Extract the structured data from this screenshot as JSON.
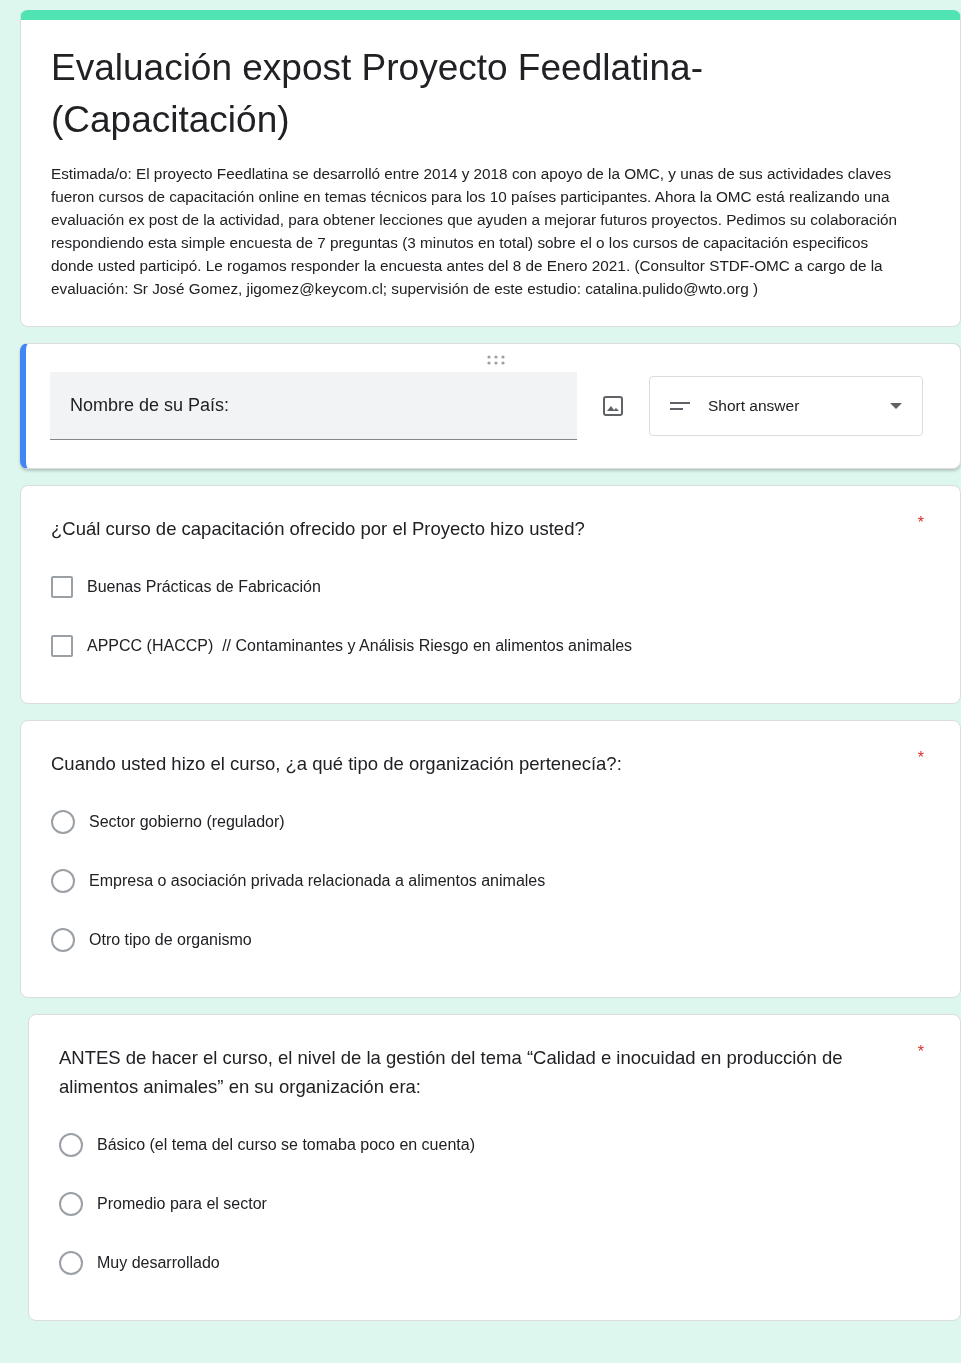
{
  "form": {
    "title": "Evaluación expost Proyecto Feedlatina-(Capacitación)",
    "description": "Estimada/o:  El proyecto Feedlatina se desarrolló entre 2014 y 2018 con apoyo de la OMC, y unas de sus actividades claves  fueron cursos de capacitación online en temas técnicos para los 10 países participantes. Ahora la OMC está realizando una evaluación ex post de la actividad, para obtener lecciones que ayuden a mejorar futuros proyectos.  Pedimos su colaboración respondiendo esta simple encuesta de 7 preguntas (3 minutos en total) sobre el o los cursos de capacitación especificos donde usted participó. Le rogamos responder la encuesta antes del 8 de Enero 2021.  (Consultor STDF-OMC a cargo de la evaluación: Sr José Gomez, jigomez@keycom.cl; supervisión de este estudio:  catalina.pulido@wto.org )"
  },
  "editing_question": {
    "title": "Nombre de su País:",
    "type": "Short answer"
  },
  "questions": [
    {
      "kind": "checkbox",
      "title": "¿Cuál curso de capacitación ofrecido por el Proyecto hizo usted?",
      "required_mark": "*",
      "options": [
        {
          "label": "Buenas Prácticas de Fabricación",
          "checked": false
        },
        {
          "label": "APPCC (HACCP)  // Contaminantes y Análisis Riesgo en alimentos animales",
          "checked": false
        }
      ]
    },
    {
      "kind": "radio",
      "title": "Cuando usted hizo el curso, ¿a qué tipo de organización pertenecía?:",
      "required_mark": "*",
      "options": [
        {
          "label": "Sector gobierno (regulador)",
          "selected": false
        },
        {
          "label": "Empresa o asociación privada relacionada a alimentos animales",
          "selected": false
        },
        {
          "label": "Otro tipo de organismo",
          "selected": false
        }
      ]
    },
    {
      "kind": "radio",
      "title": "ANTES de hacer el curso, el nivel de la gestión del tema “Calidad e inocuidad en producción de alimentos animales” en su organización era:",
      "required_mark": "*",
      "options": [
        {
          "label": "Básico (el tema del curso se tomaba poco en cuenta)",
          "selected": false
        },
        {
          "label": "Promedio para el sector",
          "selected": false
        },
        {
          "label": "Muy desarrollado",
          "selected": false
        }
      ]
    }
  ]
}
